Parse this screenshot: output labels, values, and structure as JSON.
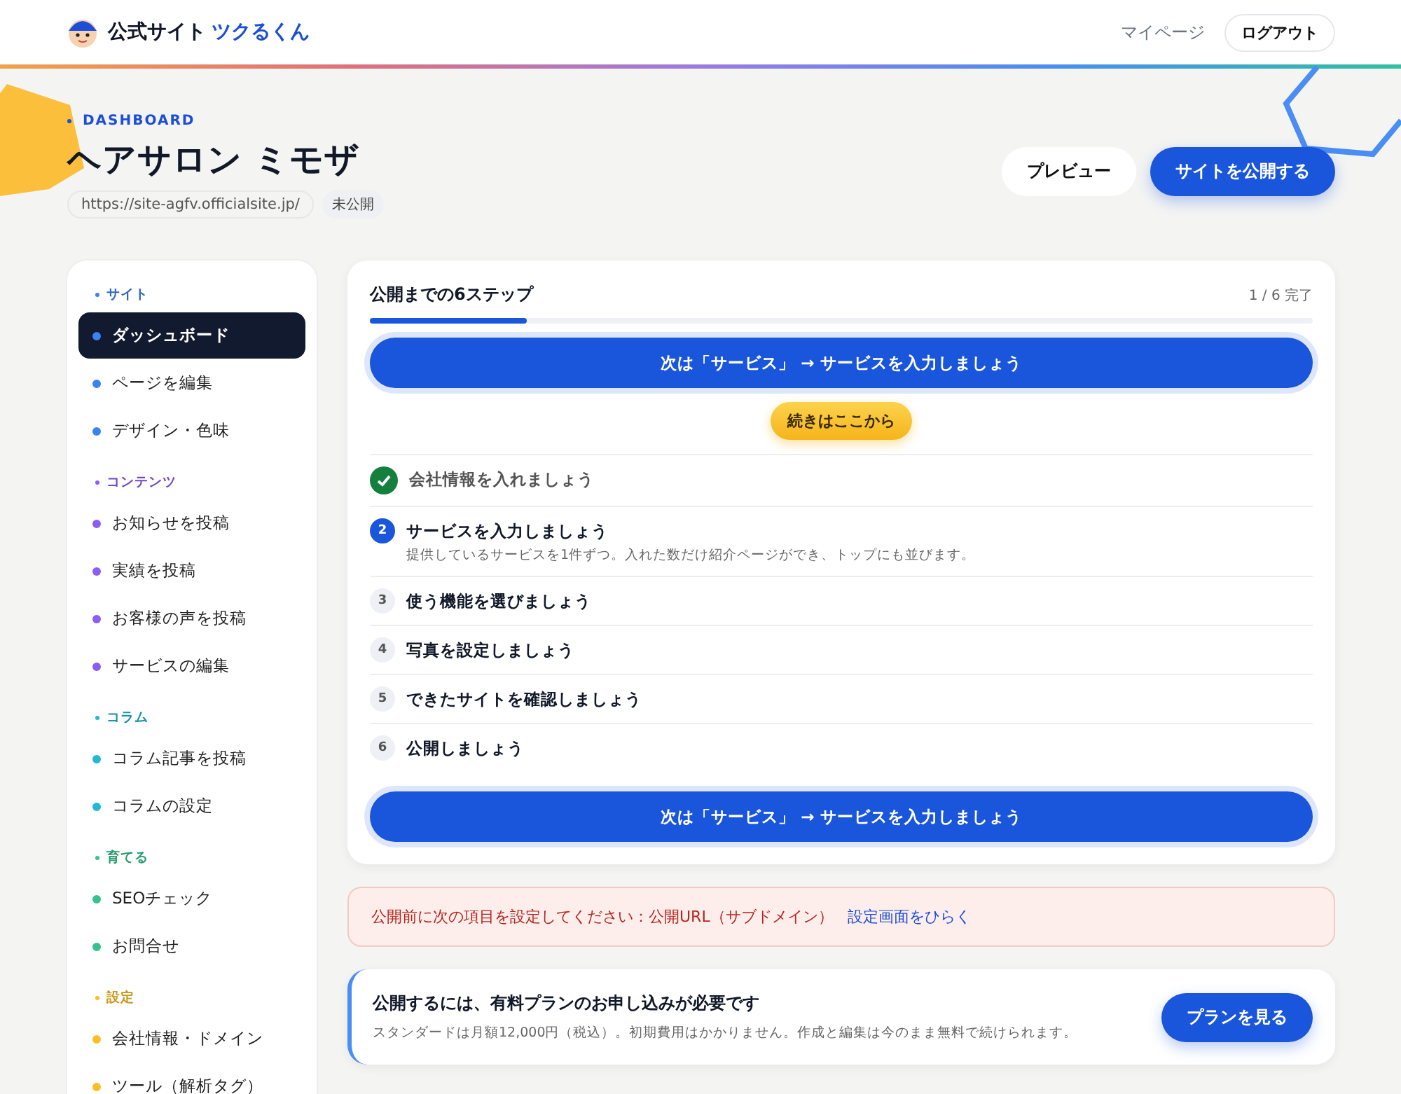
{
  "header": {
    "brand": "公式サイト",
    "brand_accent": "ツクるくん",
    "links": [
      {
        "label": "マイページ",
        "kind": "link"
      },
      {
        "label": "ログアウト",
        "kind": "button"
      }
    ]
  },
  "page": {
    "eyebrow": "DASHBOARD",
    "title": "ヘアサロン ミモザ",
    "url": "https://site-agfv.officialsite.jp/",
    "status": "未公開",
    "actions": [
      {
        "label": "プレビュー",
        "kind": "secondary"
      },
      {
        "label": "サイトを公開する",
        "kind": "primary"
      }
    ]
  },
  "sidebar": {
    "groups": [
      {
        "label": "サイト",
        "color": "#3b82f6",
        "items": [
          {
            "label": "ダッシュボード",
            "selected": true
          },
          {
            "label": "ページを編集",
            "selected": false
          },
          {
            "label": "デザイン・色味",
            "selected": false
          }
        ]
      },
      {
        "label": "コンテンツ",
        "color": "#8b5cf6",
        "items": [
          {
            "label": "お知らせを投稿",
            "selected": false
          },
          {
            "label": "実績を投稿",
            "selected": false
          },
          {
            "label": "お客様の声を投稿",
            "selected": false
          },
          {
            "label": "サービスの編集",
            "selected": false
          }
        ]
      },
      {
        "label": "コラム",
        "color": "#22b8cf",
        "items": [
          {
            "label": "コラム記事を投稿",
            "selected": false
          },
          {
            "label": "コラムの設定",
            "selected": false
          }
        ]
      },
      {
        "label": "育てる",
        "color": "#34c38f",
        "items": [
          {
            "label": "SEOチェック",
            "selected": false
          },
          {
            "label": "お問合せ",
            "selected": false
          }
        ]
      },
      {
        "label": "設定",
        "color": "#fbbf24",
        "items": [
          {
            "label": "会社情報・ドメイン",
            "selected": false
          },
          {
            "label": "ツール（解析タグ）",
            "selected": false
          }
        ]
      }
    ]
  },
  "steps_card": {
    "title": "公開までの6ステップ",
    "progress_text": "1 / 6 完了",
    "level": 0.167,
    "next_button": "次は「サービス」 → サービスを入力しましょう",
    "callout": "続きはここから",
    "steps": [
      {
        "kind": "done",
        "label": "会社情報を入れましょう"
      },
      {
        "kind": "current",
        "number": "2",
        "label": "サービスを入力しましょう",
        "description": "提供しているサービスを1件ずつ。入れた数だけ紹介ページができ、トップにも並びます。"
      },
      {
        "kind": "todo",
        "number": "3",
        "label": "使う機能を選びましょう"
      },
      {
        "kind": "todo",
        "number": "4",
        "label": "写真を設定しましょう"
      },
      {
        "kind": "todo",
        "number": "5",
        "label": "できたサイトを確認しましょう"
      },
      {
        "kind": "todo",
        "number": "6",
        "label": "公開しましょう"
      }
    ],
    "bottom_button": "次は「サービス」 → サービスを入力しましょう"
  },
  "alert": {
    "message": "公開前に次の項目を設定してください：公開URL（サブドメイン）",
    "link": "設定画面をひらく"
  },
  "plan_card": {
    "title": "公開するには、有料プランのお申し込みが必要です",
    "description": "スタンダードは月額12,000円（税込）。初期費用はかかりません。作成と編集は今のまま無料で続けられます。",
    "button": "プランを見る"
  }
}
